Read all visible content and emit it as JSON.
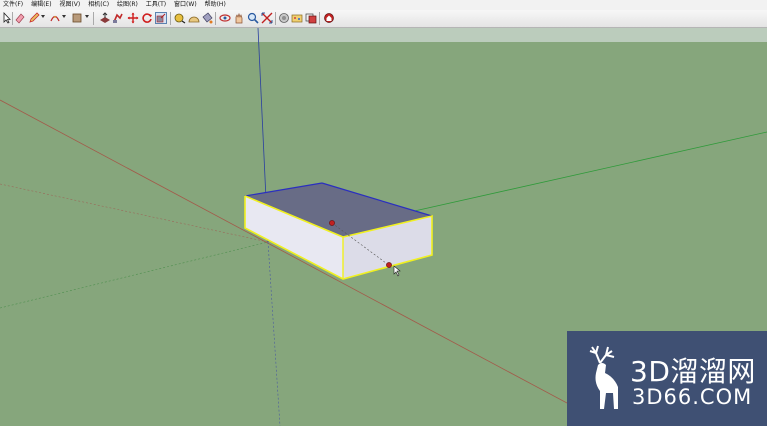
{
  "menu": {
    "items": [
      "文件(F)",
      "编辑(E)",
      "视图(V)",
      "相机(C)",
      "绘图(R)",
      "工具(T)",
      "窗口(W)",
      "帮助(H)"
    ]
  },
  "toolbar": {
    "tools": [
      {
        "icon": "select-arrow-icon",
        "color": "#222222"
      },
      {
        "icon": "eraser-icon",
        "color": "#e0607a"
      },
      {
        "icon": "pencil-icon",
        "color": "#c83030"
      },
      {
        "icon": "arc-icon",
        "color": "#c03030"
      },
      {
        "icon": "rectangle-icon",
        "color": "#8a6b4a"
      },
      {
        "icon": "push-pull-icon",
        "color": "#8a3a3a"
      },
      {
        "icon": "follow-me-icon",
        "color": "#c02a2a"
      },
      {
        "icon": "move-icon",
        "color": "#d02020"
      },
      {
        "icon": "rotate-icon",
        "color": "#d02020"
      },
      {
        "icon": "scale-icon",
        "color": "#b02020"
      },
      {
        "icon": "tape-measure-icon",
        "color": "#d8a020"
      },
      {
        "icon": "protractor-icon",
        "color": "#c88a2a"
      },
      {
        "icon": "paint-bucket-icon",
        "color": "#e07a20"
      },
      {
        "icon": "orbit-icon",
        "color": "#c03030"
      },
      {
        "icon": "pan-icon",
        "color": "#d07a40"
      },
      {
        "icon": "zoom-icon",
        "color": "#2a5aa0"
      },
      {
        "icon": "zoom-extents-icon",
        "color": "#c02020"
      },
      {
        "icon": "components-icon",
        "color": "#808080"
      },
      {
        "icon": "materials-icon",
        "color": "#e0a030"
      },
      {
        "icon": "styles-icon",
        "color": "#d04040"
      },
      {
        "icon": "warehouse-icon",
        "color": "#c02020"
      }
    ]
  },
  "scene": {
    "axis_colors": {
      "red": "#a35a4a",
      "green": "#2f9a3a",
      "blue": "#2a3fa0"
    },
    "box_colors": {
      "top": "#686c86",
      "front": "#e8e8f2",
      "side": "#dcdce8",
      "selection": "#f0f020",
      "edge": "#2a2fbf"
    }
  },
  "watermark": {
    "main_text": "3D溜溜网",
    "sub_text": "3D66.COM",
    "bg_color": "#3f5073"
  }
}
